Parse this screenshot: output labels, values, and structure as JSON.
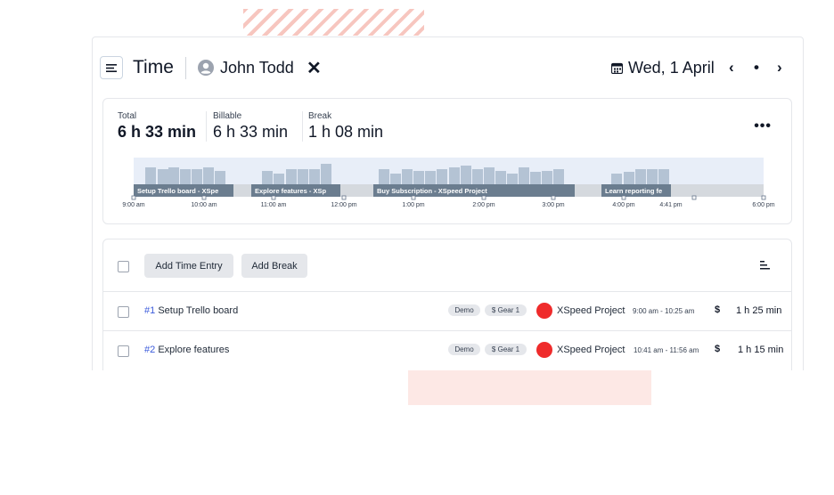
{
  "header": {
    "title": "Time",
    "user_name": "John Todd",
    "close_symbol": "✕",
    "date": "Wed, 1 April",
    "prev_symbol": "‹",
    "today_symbol": "•",
    "next_symbol": "›",
    "icons": [
      "menu-icon",
      "user-icon",
      "close-icon",
      "calendar-icon",
      "chevron-left-icon",
      "dot-icon",
      "chevron-right-icon"
    ]
  },
  "summary": {
    "total_label": "Total",
    "total_value": "6 h 33 min",
    "billable_label": "Billable",
    "billable_value": "6 h 33 min",
    "break_label": "Break",
    "break_value": "1 h 08 min",
    "more_symbol": "•••"
  },
  "timeline": {
    "segments": [
      {
        "label": "Setup Trello board - XSpe"
      },
      {
        "label": "Explore features - XSp"
      },
      {
        "label": "Buy Subscription - XSpeed Project"
      },
      {
        "label": "Learn reporting fe"
      }
    ],
    "ticks": [
      "9:00 am",
      "10:00 am",
      "11:00 am",
      "12:00 pm",
      "1:00 pm",
      "2:00 pm",
      "3:00 pm",
      "4:00 pm",
      "4:41 pm",
      "6:00 pm"
    ],
    "colors": {
      "band": "#e8eef8",
      "bar": "#b4c3d4",
      "segment": "#6b7d8f",
      "track": "#d5d9de"
    }
  },
  "toolbar": {
    "add_time_entry": "Add Time Entry",
    "add_break": "Add Break",
    "sort_icon": "sort-icon"
  },
  "entries": [
    {
      "number": "#1",
      "name": "Setup Trello board",
      "tag1": "Demo",
      "tag2": "$ Gear 1",
      "project": "XSpeed Project",
      "range": "9:00 am - 10:25 am",
      "billable": "$",
      "duration": "1 h 25 min"
    },
    {
      "number": "#2",
      "name": "Explore features",
      "tag1": "Demo",
      "tag2": "$ Gear 1",
      "project": "XSpeed Project",
      "range": "10:41 am - 11:56 am",
      "billable": "$",
      "duration": "1 h 15 min"
    }
  ],
  "colors": {
    "project_dot": "#ef2b2b",
    "link": "#3b5bdb"
  }
}
